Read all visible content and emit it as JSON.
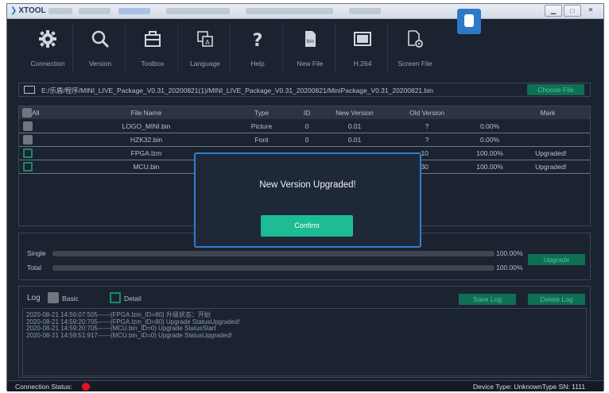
{
  "app": {
    "title": "XTOOL"
  },
  "toolbar": {
    "items": [
      {
        "label": "Connection",
        "icon": "gear-icon"
      },
      {
        "label": "Version",
        "icon": "search-icon"
      },
      {
        "label": "Toolbox",
        "icon": "toolbox-icon"
      },
      {
        "label": "Language",
        "icon": "language-icon"
      },
      {
        "label": "Help",
        "icon": "help-icon"
      },
      {
        "label": "New File",
        "icon": "bin-file-icon"
      },
      {
        "label": "H.264",
        "icon": "film-icon"
      },
      {
        "label": "Screen File",
        "icon": "screen-file-icon"
      }
    ]
  },
  "file": {
    "path": "E:/乐盾/程序/MINI_LIVE_Package_V0.31_20200821(1)/MINI_LIVE_Package_V0.31_20200821/MiniPackage_V0.31_20200821.bin",
    "choose_label": "Choose File"
  },
  "table": {
    "headers": {
      "all": "All",
      "file_name": "File Name",
      "type": "Type",
      "id": "ID",
      "new_version": "New Version",
      "old_version": "Old Version",
      "mark": "Mark"
    },
    "rows": [
      {
        "file_name": "LOGO_MINI.bin",
        "type": "Picture",
        "id": "0",
        "new_version": "0.01",
        "old_version": "?",
        "progress": "0.00%",
        "mark": "",
        "checked": false
      },
      {
        "file_name": "HZK32.bin",
        "type": "Font",
        "id": "0",
        "new_version": "0.01",
        "old_version": "?",
        "progress": "0.00%",
        "mark": "",
        "checked": false
      },
      {
        "file_name": "FPGA.lzm",
        "type": "",
        "id": "",
        "new_version": "",
        "old_version": ".10",
        "progress": "100.00%",
        "mark": "Upgraded!",
        "checked": true
      },
      {
        "file_name": "MCU.bin",
        "type": "",
        "id": "",
        "new_version": "",
        "old_version": ".30",
        "progress": "100.00%",
        "mark": "Upgraded!",
        "checked": true
      }
    ]
  },
  "progress": {
    "single_label": "Single",
    "single_value": "100.00%",
    "single_fraction": 1.0,
    "total_label": "Total",
    "total_value": "100.00%",
    "total_fraction": 1.0,
    "upgrade_label": "Upgrade"
  },
  "log": {
    "label": "Log",
    "basic_label": "Basic",
    "detail_label": "Detail",
    "save_label": "Save Log",
    "delete_label": "Delete Log",
    "lines": [
      "2020-08-21 14:56:07:505------(FPGA.lzm_ID=80)  升级状态：开始",
      "2020-08-21 14:59:20:705------(FPGA.lzm_ID=80)  Upgrade StatusUpgraded!",
      "2020-08-21 14:59:20:705------(MCU.bin_ID=0)  Upgrade StatusStart",
      "2020-08-21 14:59:51:917------(MCU.bin_ID=0)  Upgrade StatusUpgraded!"
    ]
  },
  "status": {
    "connection_label": "Connection Status:",
    "connection_color": "#e8141b",
    "device_info": "Device Type: UnknownType  SN: 1111"
  },
  "dialog": {
    "message": "New Version Upgraded!",
    "confirm_label": "Confirm"
  },
  "colors": {
    "accent": "#1dbc94",
    "dialog_border": "#2f7fd0",
    "background": "#1b2331"
  }
}
